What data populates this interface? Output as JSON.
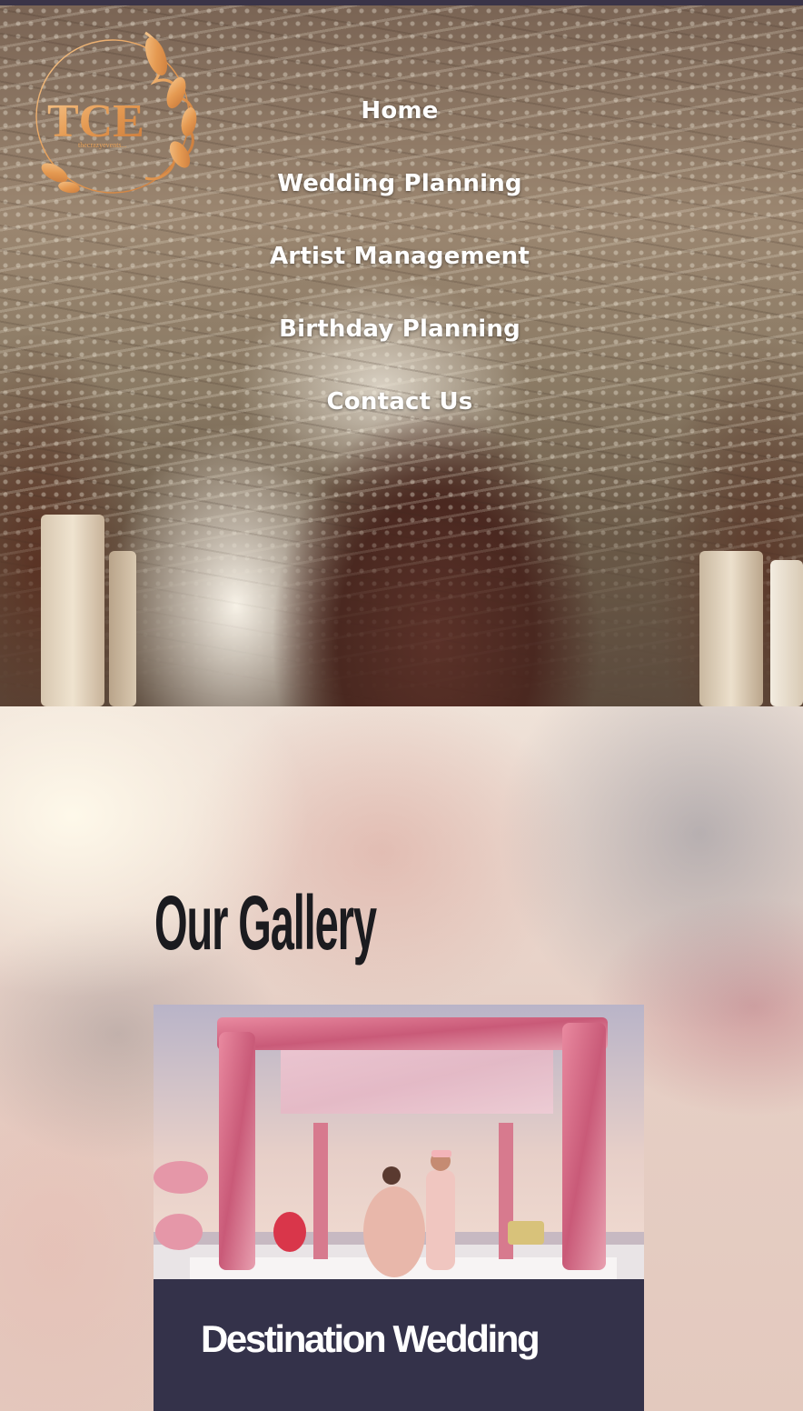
{
  "logo": {
    "initials": "TCE",
    "tagline": "thecrazyevents..."
  },
  "nav": {
    "items": [
      {
        "label": "Home"
      },
      {
        "label": "Wedding Planning"
      },
      {
        "label": "Artist Management"
      },
      {
        "label": "Birthday Planning"
      },
      {
        "label": "Contact Us"
      }
    ]
  },
  "gallery": {
    "title": "Our Gallery",
    "cards": [
      {
        "title": "Destination Wedding"
      }
    ]
  },
  "colors": {
    "top_strip": "#3a3448",
    "logo_gold": "#e8a35b",
    "card_caption_bg": "#34324a",
    "nav_text": "#ffffff"
  }
}
